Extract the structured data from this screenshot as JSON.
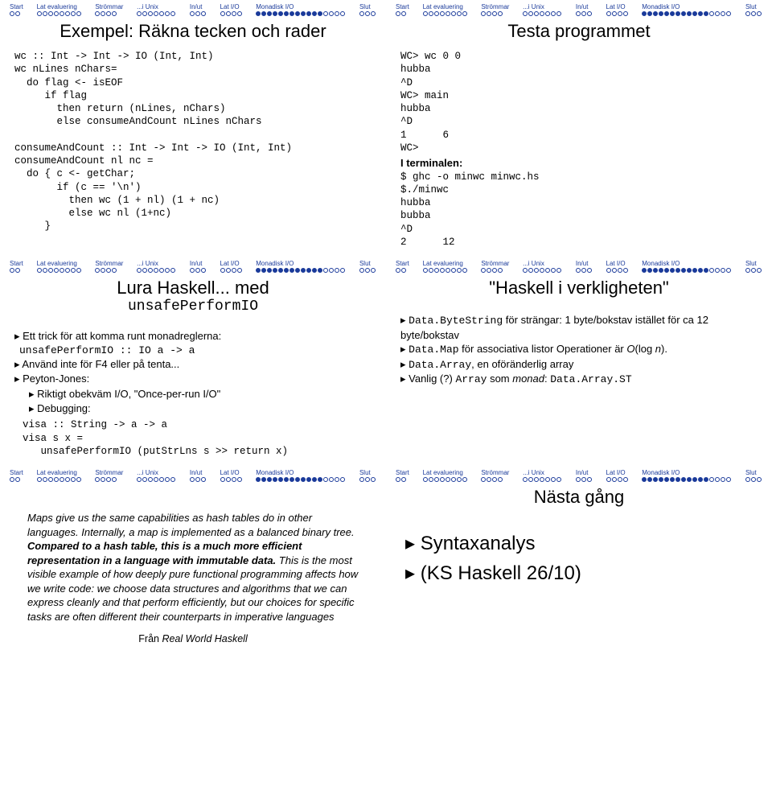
{
  "nav": {
    "labels": [
      "Start",
      "Lat evaluering",
      "Strömmar",
      "...i Unix",
      "In/ut",
      "Lat I/O",
      "Monadisk I/O",
      "Slut"
    ],
    "counts": [
      2,
      8,
      4,
      7,
      3,
      4,
      16,
      3
    ]
  },
  "slides": {
    "s1": {
      "title": "Exempel: Räkna tecken och rader",
      "code": "wc :: Int -> Int -> IO (Int, Int)\nwc nLines nChars=\n  do flag <- isEOF\n     if flag\n       then return (nLines, nChars)\n       else consumeAndCount nLines nChars\n\nconsumeAndCount :: Int -> Int -> IO (Int, Int)\nconsumeAndCount nl nc =\n  do { c <- getChar;\n       if (c == '\\n')\n         then wc (1 + nl) (1 + nc)\n         else wc nl (1+nc)\n     }"
    },
    "s2": {
      "title": "Testa programmet",
      "code1": "WC> wc 0 0\nhubba\n^D\nWC> main\nhubba\n^D\n1      6\nWC>",
      "term_label": "I terminalen:",
      "code2": "$ ghc -o minwc minwc.hs\n$./minwc\nhubba\nbubba\n^D\n2      12"
    },
    "s3": {
      "title": "Lura Haskell... med",
      "sub": "unsafePerformIO",
      "b1": "Ett trick för att komma runt monadreglerna:",
      "c1": "unsafePerformIO :: IO a -> a",
      "b2": "Använd inte för F4 eller på tenta...",
      "b3": "Peyton-Jones:",
      "b3a": "Riktigt obekväm I/O, \"Once-per-run I/O\"",
      "b3b": "Debugging:",
      "c2": "visa :: String -> a -> a\nvisa s x =\n   unsafePerformIO (putStrLns s >> return x)"
    },
    "s4": {
      "title": "\"Haskell i verkligheten\"",
      "b1a": "Data.ByteString",
      "b1b": " för strängar: 1 byte/bokstav istället för ca 12 byte/bokstav",
      "b2a": "Data.Map",
      "b2b": " för associativa listor Operationer är ",
      "b2c": "O",
      "b2d": "(log ",
      "b2e": "n",
      "b2f": ").",
      "b3a": "Data.Array",
      "b3b": ", en oföränderlig array",
      "b4a": "Vanlig (?) ",
      "b4b": "Array",
      "b4c": " som ",
      "b4d": "monad",
      "b4e": ": ",
      "b4f": "Data.Array.ST"
    },
    "s5": {
      "q1": "Maps give us the same capabilities as hash tables do in other languages. Internally, a map is implemented as a balanced binary tree. ",
      "q2": "Compared to a hash table, this is a much more efficient representation in a language with immutable data.",
      "q3": " This is the most visible example of how deeply pure functional programming affects how we write code: we choose data structures and algorithms that we can express cleanly and that perform efficiently, but our choices for specific tasks are often different their counterparts in imperative languages",
      "cite_pre": "Från ",
      "cite": "Real World Haskell"
    },
    "s6": {
      "title": "Nästa gång",
      "b1": "Syntaxanalys",
      "b2": "(KS Haskell 26/10)"
    }
  }
}
